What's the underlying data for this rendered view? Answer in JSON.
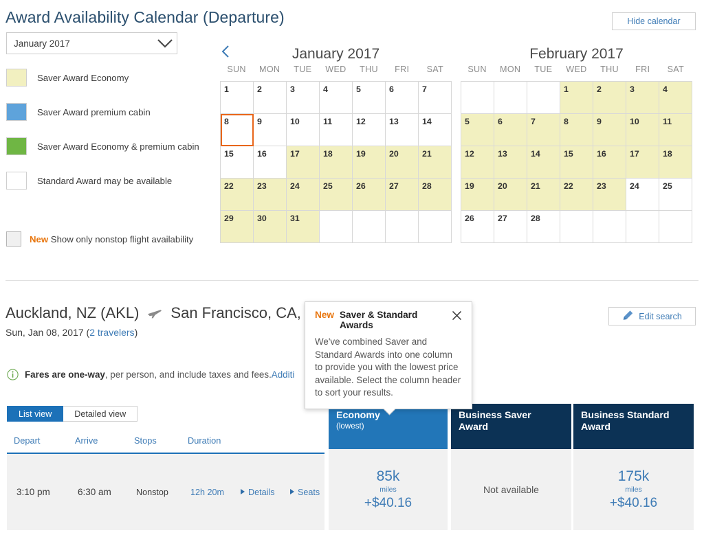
{
  "header": {
    "title": "Award Availability Calendar (Departure)",
    "hide_calendar_label": "Hide calendar"
  },
  "month_select": {
    "value": "January 2017",
    "icon": "chevron-down-icon"
  },
  "legend": {
    "items": [
      {
        "label": "Saver Award Economy",
        "color": "#f2f0c0"
      },
      {
        "label": "Saver Award premium cabin",
        "color": "#5ea3db"
      },
      {
        "label": "Saver Award Economy & premium cabin",
        "color": "#6fb644"
      },
      {
        "label": "Standard Award may be available",
        "color": "#ffffff"
      }
    ]
  },
  "nonstop": {
    "new_tag": "New",
    "label": "Show only nonstop flight availability",
    "checked": false
  },
  "calendars": {
    "prev_icon": "chevron-left-icon",
    "dow": [
      "SUN",
      "MON",
      "TUE",
      "WED",
      "THU",
      "FRI",
      "SAT"
    ],
    "months": [
      {
        "title": "January 2017",
        "weeks": [
          [
            {
              "d": "1",
              "s": "none"
            },
            {
              "d": "2",
              "s": "none"
            },
            {
              "d": "3",
              "s": "none"
            },
            {
              "d": "4",
              "s": "none"
            },
            {
              "d": "5",
              "s": "none"
            },
            {
              "d": "6",
              "s": "none"
            },
            {
              "d": "7",
              "s": "none"
            }
          ],
          [
            {
              "d": "8",
              "s": "none",
              "selected": true
            },
            {
              "d": "9",
              "s": "none"
            },
            {
              "d": "10",
              "s": "none"
            },
            {
              "d": "11",
              "s": "none"
            },
            {
              "d": "12",
              "s": "none"
            },
            {
              "d": "13",
              "s": "none"
            },
            {
              "d": "14",
              "s": "none"
            }
          ],
          [
            {
              "d": "15",
              "s": "none"
            },
            {
              "d": "16",
              "s": "none"
            },
            {
              "d": "17",
              "s": "econ"
            },
            {
              "d": "18",
              "s": "econ"
            },
            {
              "d": "19",
              "s": "econ"
            },
            {
              "d": "20",
              "s": "econ"
            },
            {
              "d": "21",
              "s": "econ"
            }
          ],
          [
            {
              "d": "22",
              "s": "econ"
            },
            {
              "d": "23",
              "s": "econ"
            },
            {
              "d": "24",
              "s": "econ"
            },
            {
              "d": "25",
              "s": "econ"
            },
            {
              "d": "26",
              "s": "econ"
            },
            {
              "d": "27",
              "s": "econ"
            },
            {
              "d": "28",
              "s": "econ"
            }
          ],
          [
            {
              "d": "29",
              "s": "econ"
            },
            {
              "d": "30",
              "s": "econ"
            },
            {
              "d": "31",
              "s": "econ"
            },
            {
              "d": "",
              "s": "blank"
            },
            {
              "d": "",
              "s": "blank"
            },
            {
              "d": "",
              "s": "blank"
            },
            {
              "d": "",
              "s": "blank"
            }
          ]
        ]
      },
      {
        "title": "February 2017",
        "weeks": [
          [
            {
              "d": "",
              "s": "blank"
            },
            {
              "d": "",
              "s": "blank"
            },
            {
              "d": "",
              "s": "blank"
            },
            {
              "d": "1",
              "s": "econ"
            },
            {
              "d": "2",
              "s": "econ"
            },
            {
              "d": "3",
              "s": "econ"
            },
            {
              "d": "4",
              "s": "econ"
            }
          ],
          [
            {
              "d": "5",
              "s": "econ"
            },
            {
              "d": "6",
              "s": "econ"
            },
            {
              "d": "7",
              "s": "econ"
            },
            {
              "d": "8",
              "s": "econ"
            },
            {
              "d": "9",
              "s": "econ"
            },
            {
              "d": "10",
              "s": "econ"
            },
            {
              "d": "11",
              "s": "econ"
            }
          ],
          [
            {
              "d": "12",
              "s": "econ"
            },
            {
              "d": "13",
              "s": "econ"
            },
            {
              "d": "14",
              "s": "econ"
            },
            {
              "d": "15",
              "s": "econ"
            },
            {
              "d": "16",
              "s": "econ"
            },
            {
              "d": "17",
              "s": "econ"
            },
            {
              "d": "18",
              "s": "econ"
            }
          ],
          [
            {
              "d": "19",
              "s": "econ"
            },
            {
              "d": "20",
              "s": "econ"
            },
            {
              "d": "21",
              "s": "econ"
            },
            {
              "d": "22",
              "s": "econ"
            },
            {
              "d": "23",
              "s": "econ"
            },
            {
              "d": "24",
              "s": "none"
            },
            {
              "d": "25",
              "s": "none"
            }
          ],
          [
            {
              "d": "26",
              "s": "none"
            },
            {
              "d": "27",
              "s": "none"
            },
            {
              "d": "28",
              "s": "none"
            },
            {
              "d": "",
              "s": "blank"
            },
            {
              "d": "",
              "s": "blank"
            },
            {
              "d": "",
              "s": "blank"
            },
            {
              "d": "",
              "s": "blank"
            }
          ]
        ]
      }
    ]
  },
  "route": {
    "origin": "Auckland, NZ (AKL)",
    "plane_icon": "airplane-icon",
    "destination": "San Francisco, CA, U",
    "date": "Sun, Jan 08, 2017 (",
    "travelers": "2 travelers",
    "date_close": ")",
    "edit_search_label": "Edit search",
    "edit_search_icon": "pencil-icon"
  },
  "fares_note": {
    "icon": "info-icon",
    "bold": "Fares are one-way",
    "rest": ", per person, and include taxes and fees. ",
    "link": "Additi"
  },
  "tooltip": {
    "new_tag": "New",
    "title": "Saver & Standard Awards",
    "close_icon": "close-icon",
    "body": "We've combined Saver and Standard Awards into one column to provide you with the lowest price available. Select the column header to sort your results."
  },
  "view_tabs": [
    {
      "label": "List view",
      "active": true
    },
    {
      "label": "Detailed view",
      "active": false
    }
  ],
  "results_table": {
    "columns": [
      "Depart",
      "Arrive",
      "Stops",
      "Duration"
    ],
    "row": {
      "depart": "3:10 pm",
      "arrive": "6:30 am",
      "stops": "Nonstop",
      "duration": "12h 20m",
      "details_label": "Details",
      "seats_label": "Seats"
    }
  },
  "fare_columns": [
    {
      "title": "Economy",
      "subtitle": "(lowest)",
      "style": "primary",
      "available": true,
      "miles": "85k",
      "miles_label": "miles",
      "cash": "+$40.16"
    },
    {
      "title": "Business Saver",
      "title2": "Award",
      "subtitle": "",
      "style": "dark",
      "available": false,
      "not_available_label": "Not available"
    },
    {
      "title": "Business Standard",
      "title2": "Award",
      "subtitle": "",
      "style": "dark",
      "available": true,
      "miles": "175k",
      "miles_label": "miles",
      "cash": "+$40.16"
    }
  ],
  "colors": {
    "brand_blue": "#1c71b8",
    "dark_navy": "#0c3255",
    "link_blue": "#3f7cb6",
    "orange": "#e8760f",
    "selected_outline": "#e8661a"
  }
}
